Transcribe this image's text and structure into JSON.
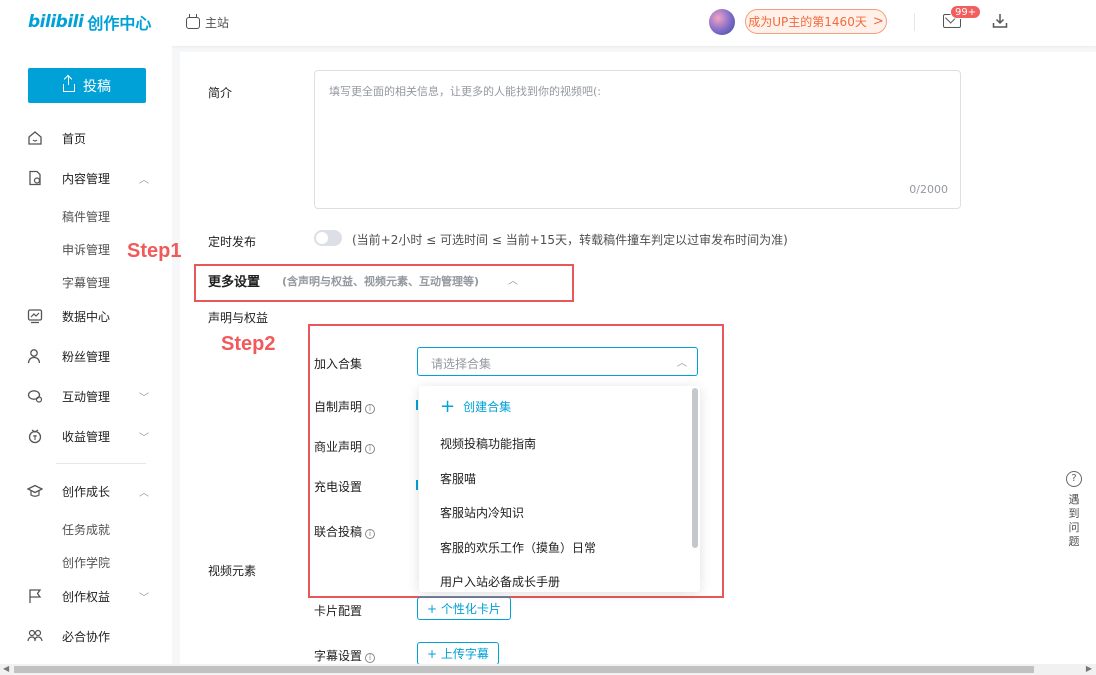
{
  "header": {
    "logo_brand": "bilibili",
    "logo_text": "创作中心",
    "home_link": "主站",
    "up_days": "成为UP主的第1460天",
    "up_days_arrow": ">",
    "mail_badge": "99+"
  },
  "sidebar": {
    "upload_label": "投稿",
    "items": [
      {
        "label": "首页",
        "icon": "home-icon"
      },
      {
        "label": "内容管理",
        "icon": "document-icon",
        "chevron": "up"
      },
      {
        "label": "数据中心",
        "icon": "chart-icon"
      },
      {
        "label": "粉丝管理",
        "icon": "user-icon"
      },
      {
        "label": "互动管理",
        "icon": "chat-icon",
        "chevron": "down"
      },
      {
        "label": "收益管理",
        "icon": "money-icon",
        "chevron": "down"
      },
      {
        "label": "创作成长",
        "icon": "graduation-icon",
        "chevron": "up"
      },
      {
        "label": "创作权益",
        "icon": "flag-icon",
        "chevron": "down"
      },
      {
        "label": "必合协作",
        "icon": "people-icon"
      }
    ],
    "content_sub": [
      "稿件管理",
      "申诉管理",
      "字幕管理"
    ],
    "growth_sub": [
      "任务成就",
      "创作学院"
    ]
  },
  "form": {
    "intro_label": "简介",
    "intro_placeholder": "填写更全面的相关信息，让更多的人能找到你的视频吧(:",
    "intro_count": "0/2000",
    "schedule_label": "定时发布",
    "schedule_note": "(当前+2小时 ≤ 可选时间 ≤ 当前+15天，转载稿件撞车判定以过审发布时间为准)",
    "more_title": "更多设置",
    "more_sub": "(含声明与权益、视频元素、互动管理等)",
    "rights_label": "声明与权益",
    "collection_label": "加入合集",
    "collection_placeholder": "请选择合集",
    "self_made_label": "自制声明",
    "commercial_label": "商业声明",
    "charge_label": "充电设置",
    "joint_label": "联合投稿",
    "video_elements_label": "视频元素",
    "card_label": "卡片配置",
    "card_button": "+ 个性化卡片",
    "subtitle_label": "字幕设置",
    "subtitle_button": "+ 上传字幕"
  },
  "dropdown": {
    "create_label": "创建合集",
    "options": [
      "视频投稿功能指南",
      "客服喵",
      "客服站内冷知识",
      "客服的欢乐工作（摸鱼）日常",
      "用户入站必备成长手册"
    ]
  },
  "annotations": {
    "step1": "Step1",
    "step2": "Step2"
  },
  "help": {
    "icon": "?",
    "label": "遇到问题"
  },
  "colors": {
    "accent": "#00a1d6",
    "annotation_red": "#e8575a",
    "pill_orange": "#f06b3b"
  }
}
